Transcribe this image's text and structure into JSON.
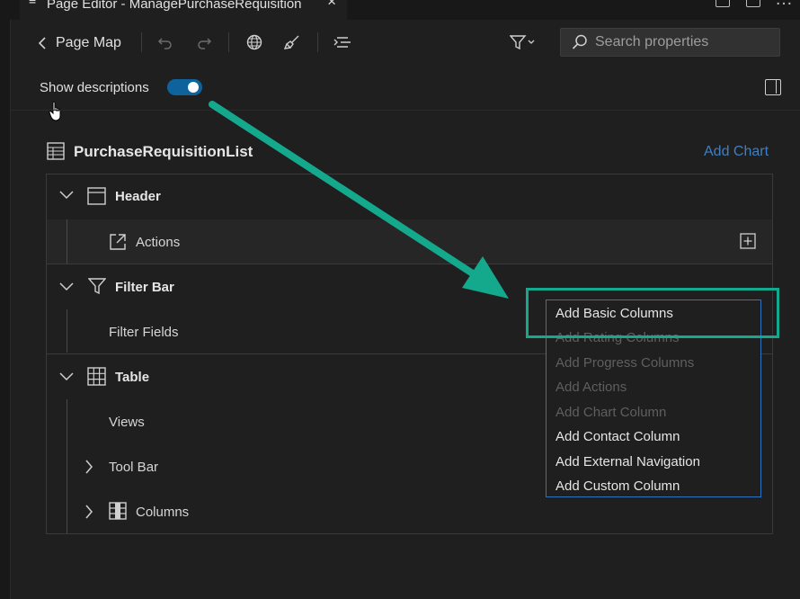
{
  "tab": {
    "title": "Page Editor - ManagePurchaseRequisition"
  },
  "toolbar": {
    "back_label": "Page Map",
    "search_placeholder": "Search properties"
  },
  "descriptions": {
    "label": "Show descriptions",
    "enabled": true
  },
  "page": {
    "title": "PurchaseRequisitionList",
    "add_chart": "Add Chart"
  },
  "tree": {
    "header": "Header",
    "actions": "Actions",
    "filter_bar": "Filter Bar",
    "filter_fields": "Filter Fields",
    "table": "Table",
    "views": "Views",
    "tool_bar": "Tool Bar",
    "columns": "Columns"
  },
  "dropdown": {
    "items": [
      {
        "label": "Add Basic Columns",
        "enabled": true
      },
      {
        "label": "Add Rating Columns",
        "enabled": false
      },
      {
        "label": "Add Progress Columns",
        "enabled": false
      },
      {
        "label": "Add Actions",
        "enabled": false
      },
      {
        "label": "Add Chart Column",
        "enabled": false
      },
      {
        "label": "Add Contact Column",
        "enabled": true
      },
      {
        "label": "Add External Navigation",
        "enabled": true
      },
      {
        "label": "Add Custom Column",
        "enabled": true
      }
    ]
  },
  "colors": {
    "accent": "#0e639c",
    "highlight": "#14a88c",
    "arrow": "#14a88c",
    "link": "#3f7fc4"
  }
}
